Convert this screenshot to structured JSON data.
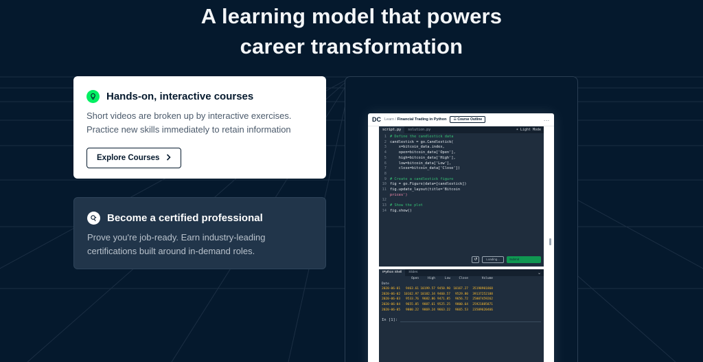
{
  "headline": {
    "line1": "A learning model that powers",
    "line2": "career transformation"
  },
  "features": [
    {
      "title": "Hands-on, interactive courses",
      "icon": "lightbulb-icon",
      "desc_line1": "Short videos are broken up by interactive exercises.",
      "desc_line2": "Practice new skills immediately to retain information",
      "button_label": "Explore Courses"
    },
    {
      "title": "Become a certified professional",
      "icon": "certificate-icon",
      "desc_line1": "Prove you're job-ready. Earn industry-leading",
      "desc_line2": "certifications built around in-demand roles."
    }
  ],
  "mockup": {
    "topbar": {
      "logo": "DC",
      "crumb_learn": "Learn",
      "crumb_sep": "/",
      "crumb_course": "Financial Trading in Python",
      "outline_button": "Course Outline",
      "more": "..."
    },
    "editor": {
      "tab_active": "script.py",
      "tab_other": "solution.py",
      "light_mode": "Light Mode",
      "lines": [
        {
          "n": "1",
          "t": "# Define the candlestick data",
          "k": "comment"
        },
        {
          "n": "2",
          "t": "candlestick = go.Candlestick(",
          "k": ""
        },
        {
          "n": "3",
          "t": "    x=bitcoin_data.index,",
          "k": ""
        },
        {
          "n": "4",
          "t": "    open=bitcoin_data['Open'],",
          "k": ""
        },
        {
          "n": "5",
          "t": "    high=bitcoin_data['High'],",
          "k": ""
        },
        {
          "n": "6",
          "t": "    low=bitcoin_data['Low'],",
          "k": ""
        },
        {
          "n": "7",
          "t": "    close=bitcoin_data['Close'])",
          "k": ""
        },
        {
          "n": "8",
          "t": "",
          "k": ""
        },
        {
          "n": "9",
          "t": "# Create a candlestick figure",
          "k": "comment"
        },
        {
          "n": "10",
          "t": "fig = go.Figure(data=[candlestick])",
          "k": ""
        },
        {
          "n": "11",
          "t": "fig.update_layout(title='Bitcoin",
          "k": ""
        },
        {
          "n": "",
          "t": "prices')",
          "k": "str"
        },
        {
          "n": "12",
          "t": "",
          "k": ""
        },
        {
          "n": "13",
          "t": "# Show the plot",
          "k": "comment"
        },
        {
          "n": "14",
          "t": "fig.show()",
          "k": ""
        }
      ],
      "reset_icon": "↺",
      "loading_label": "Loading...",
      "run_label": "Submit"
    },
    "shell": {
      "tab_active": "IPython Shell",
      "tab_other": "Slides",
      "caret": "⌄",
      "header": [
        "",
        "Open",
        "High",
        "Low",
        "Close",
        "Volume"
      ],
      "index_label": "Date",
      "rows": [
        [
          "2020-06-01",
          "9463.61",
          "10199.57",
          "9450.90",
          "10167.27",
          "35198901868"
        ],
        [
          "2020-06-02",
          "10162.97",
          "10182.34",
          "9460.57",
          "9529.80",
          "39137252188"
        ],
        [
          "2020-06-03",
          "9533.76",
          "9682.86",
          "9471.85",
          "9656.72",
          "25007459262"
        ],
        [
          "2020-06-04",
          "9655.85",
          "9887.61",
          "9525.25",
          "9800.64",
          "25921885871"
        ],
        [
          "2020-06-05",
          "9800.22",
          "9869.24",
          "9663.22",
          "9665.53",
          "23509620466"
        ]
      ],
      "prompt": "In [1]:"
    }
  }
}
